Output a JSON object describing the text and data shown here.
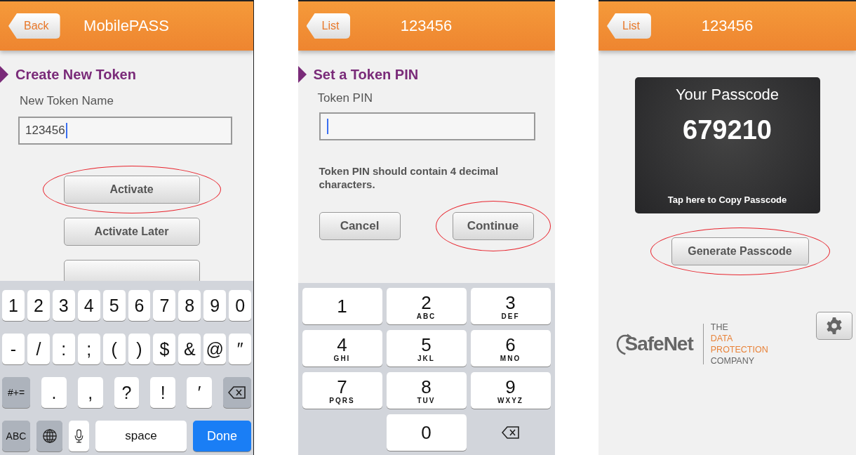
{
  "screens": [
    {
      "kind": "create",
      "header": {
        "back": "Back",
        "title": "MobilePASS"
      },
      "section_title": "Create New Token",
      "field": {
        "label": "New Token Name",
        "value": "123456",
        "focused": true
      },
      "buttons": [
        {
          "label": "Activate",
          "highlighted": true
        },
        {
          "label": "Activate Later",
          "highlighted": false
        }
      ],
      "covered_button": true,
      "keyboard": {
        "number_row": [
          {
            "kind": "char",
            "label": "1"
          },
          {
            "kind": "char",
            "label": "2"
          },
          {
            "kind": "char",
            "label": "3"
          },
          {
            "kind": "char",
            "label": "4"
          },
          {
            "kind": "char",
            "label": "5"
          },
          {
            "kind": "char",
            "label": "6"
          },
          {
            "kind": "char",
            "label": "7"
          },
          {
            "kind": "char",
            "label": "8"
          },
          {
            "kind": "char",
            "label": "9"
          },
          {
            "kind": "char",
            "label": "0"
          }
        ],
        "symbol_row": [
          {
            "kind": "char",
            "label": "-"
          },
          {
            "kind": "char",
            "label": "/"
          },
          {
            "kind": "char",
            "label": ":"
          },
          {
            "kind": "char",
            "label": ";"
          },
          {
            "kind": "char",
            "label": "("
          },
          {
            "kind": "char",
            "label": ")"
          },
          {
            "kind": "char",
            "label": "$"
          },
          {
            "kind": "char",
            "label": "&"
          },
          {
            "kind": "char",
            "label": "@"
          },
          {
            "kind": "char",
            "label": "″"
          }
        ],
        "punctuation_row": [
          {
            "kind": "mod",
            "label": "#+="
          },
          {
            "kind": "char",
            "label": "."
          },
          {
            "kind": "char",
            "label": ","
          },
          {
            "kind": "char",
            "label": "?"
          },
          {
            "kind": "char",
            "label": "!"
          },
          {
            "kind": "char",
            "label": "′"
          },
          {
            "kind": "backspace"
          }
        ],
        "bottom_row": [
          {
            "kind": "mod",
            "label": "ABC"
          },
          {
            "kind": "globe"
          },
          {
            "kind": "mic"
          },
          {
            "kind": "space",
            "label": "space"
          },
          {
            "kind": "done",
            "label": "Done"
          }
        ]
      }
    },
    {
      "kind": "pin",
      "header": {
        "back": "List",
        "title": "123456"
      },
      "section_title": "Set a Token PIN",
      "field": {
        "label": "Token PIN",
        "focused": true
      },
      "hint": "Token PIN should contain 4 decimal characters.",
      "buttons": [
        {
          "label": "Cancel",
          "highlighted": false
        },
        {
          "label": "Continue",
          "highlighted": true
        }
      ],
      "keypad": [
        {
          "kind": "digit",
          "digit": "1"
        },
        {
          "kind": "digit",
          "digit": "2",
          "letters": "ABC"
        },
        {
          "kind": "digit",
          "digit": "3",
          "letters": "DEF"
        },
        {
          "kind": "digit",
          "digit": "4",
          "letters": "GHI"
        },
        {
          "kind": "digit",
          "digit": "5",
          "letters": "JKL"
        },
        {
          "kind": "digit",
          "digit": "6",
          "letters": "MNO"
        },
        {
          "kind": "digit",
          "digit": "7",
          "letters": "PQRS"
        },
        {
          "kind": "digit",
          "digit": "8",
          "letters": "TUV"
        },
        {
          "kind": "digit",
          "digit": "9",
          "letters": "WXYZ"
        },
        {
          "kind": "blank"
        },
        {
          "kind": "digit",
          "digit": "0"
        },
        {
          "kind": "backspace"
        }
      ]
    },
    {
      "kind": "passcode",
      "header": {
        "back": "List",
        "title": "123456"
      },
      "card": {
        "title": "Your Passcode",
        "code": "679210",
        "copy_hint": "Tap here to Copy Passcode"
      },
      "buttons": [
        {
          "label": "Generate Passcode",
          "highlighted": true
        }
      ],
      "logo": {
        "name": "SafeNet",
        "tagline": [
          {
            "text": "THE",
            "color": "#666666"
          },
          {
            "text": "DATA",
            "color": "#e8833a"
          },
          {
            "text": "PROTECTION",
            "color": "#e8833a"
          },
          {
            "text": "COMPANY",
            "color": "#666666"
          }
        ]
      },
      "settings_button": true
    }
  ]
}
